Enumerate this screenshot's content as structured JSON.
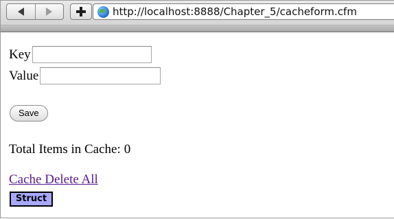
{
  "browser": {
    "url": "http://localhost:8888/Chapter_5/cacheform.cfm",
    "icons": {
      "back": "back-arrow-icon",
      "forward": "forward-arrow-icon",
      "add": "plus-icon",
      "site": "globe-icon"
    }
  },
  "form": {
    "key_label": "Key",
    "key_value": "",
    "value_label": "Value",
    "value_value": "",
    "save_label": "Save"
  },
  "cache": {
    "total_label": "Total Items in Cache:",
    "total_count": "0",
    "delete_all_label": "Cache Delete All"
  },
  "dump": {
    "struct_label": "Struct",
    "header_color": "#a8a8ff"
  },
  "colors": {
    "visited_link": "#551a8b",
    "toolbar": "#d6d6d6"
  }
}
